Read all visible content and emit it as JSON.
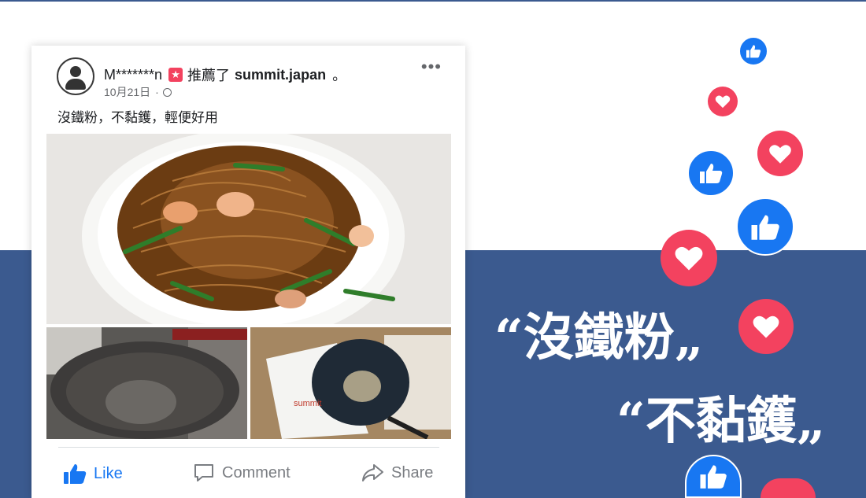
{
  "post": {
    "author": "M*******n",
    "recommend_prefix": "推薦了",
    "page_name": "summit.japan",
    "after_page": "。",
    "date": "10月21日",
    "date_separator": "·",
    "more_label": "•••",
    "text": "沒鐵粉，不黏鑊，輕便好用"
  },
  "actions": {
    "like": "Like",
    "comment": "Comment",
    "share": "Share"
  },
  "quotes": {
    "line1": "沒鐵粉",
    "line2": "不黏鑊",
    "open": "“",
    "close": "„"
  },
  "colors": {
    "band": "#3b5a8f",
    "like_blue": "#1877f2",
    "love_red": "#f3425f"
  },
  "icons": [
    "user-avatar-icon",
    "recommend-icon",
    "globe-icon",
    "more-icon",
    "thumbs-up-icon",
    "comment-icon",
    "share-icon",
    "heart-icon"
  ]
}
